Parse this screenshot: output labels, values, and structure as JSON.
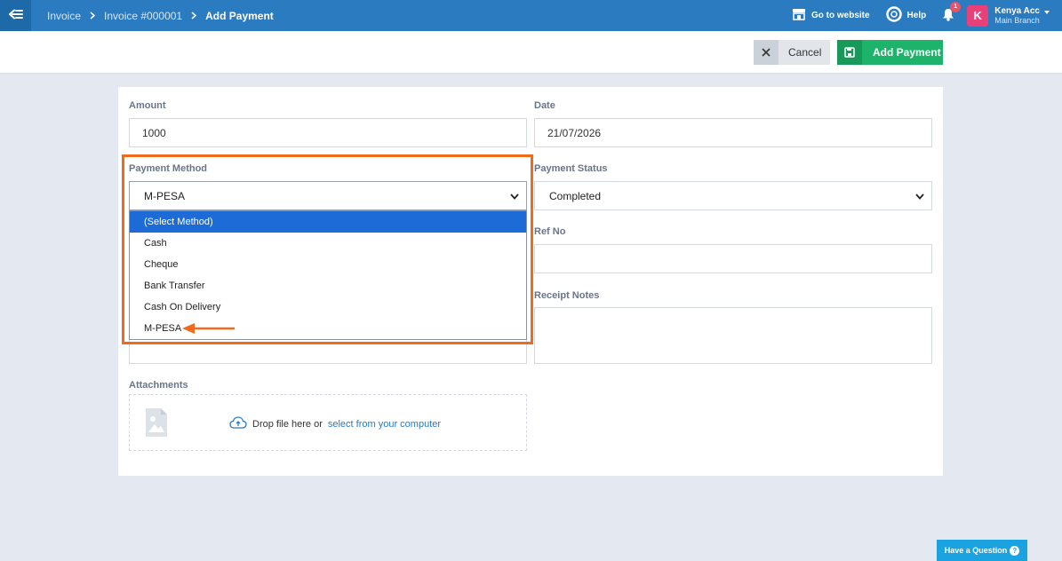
{
  "breadcrumb": {
    "items": [
      "Invoice",
      "Invoice #000001",
      "Add Payment"
    ]
  },
  "topbar": {
    "go_to_website": "Go to website",
    "help": "Help",
    "notification_count": "1",
    "account_initial": "K",
    "account_name": "Kenya Acc",
    "account_branch": "Main Branch"
  },
  "actions": {
    "cancel_label": "Cancel",
    "add_payment_label": "Add Payment"
  },
  "form": {
    "amount_label": "Amount",
    "amount_value": "1000",
    "date_label": "Date",
    "date_value": "21/07/2026",
    "payment_method_label": "Payment Method",
    "payment_method_value": "M-PESA",
    "payment_status_label": "Payment Status",
    "payment_status_value": "Completed",
    "ref_no_label": "Ref No",
    "receipt_notes_label": "Receipt Notes",
    "attachments_label": "Attachments",
    "drop_text": "Drop file here or",
    "drop_link": "select from your computer"
  },
  "dropdown": {
    "options": [
      "(Select Method)",
      "Cash",
      "Cheque",
      "Bank Transfer",
      "Cash On Delivery",
      "M-PESA"
    ]
  },
  "help_button": "Have a Question",
  "colors": {
    "topbar": "#2a7bc0",
    "add_button": "#1eb36a",
    "highlight": "#f26a1b",
    "selected_option": "#1c6bd6"
  }
}
